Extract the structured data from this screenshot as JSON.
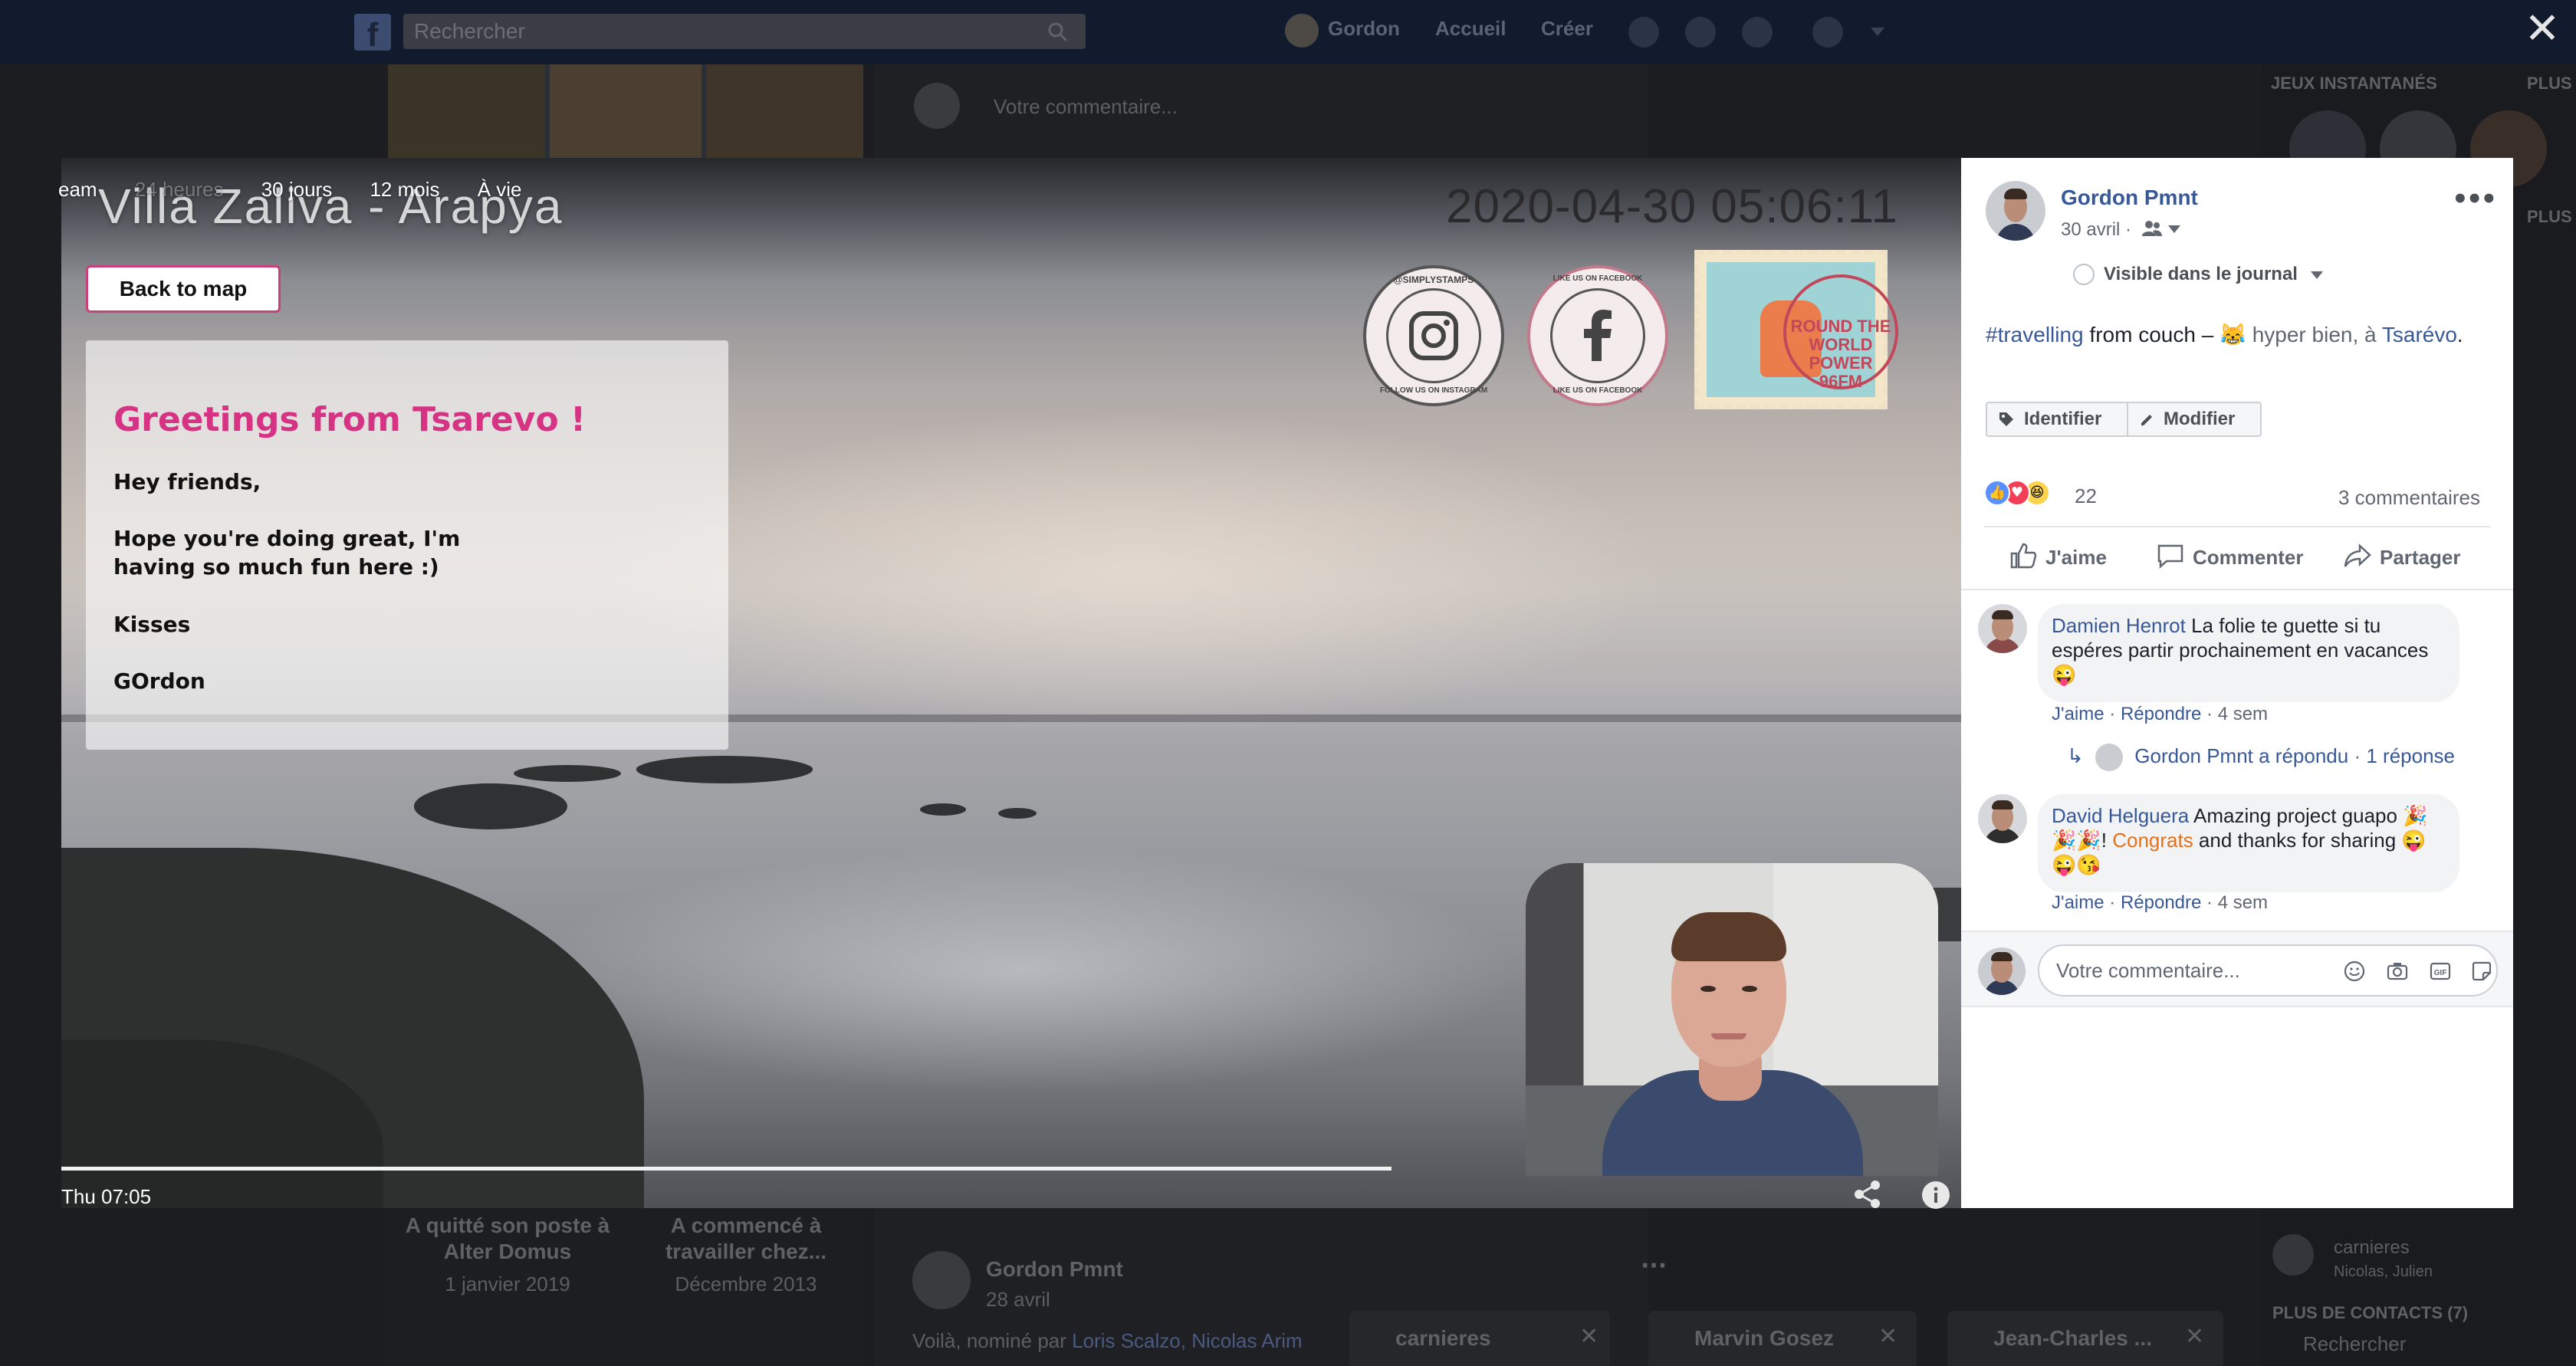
{
  "fb_header": {
    "search_placeholder": "Rechercher",
    "user_name": "Gordon",
    "nav_home": "Accueil",
    "nav_create": "Créer"
  },
  "background": {
    "left_item_1": "A quitté son poste à Alter Domus",
    "left_item_1_date": "1 janvier 2019",
    "left_item_2": "A commencé à travailler chez...",
    "left_item_2_date": "Décembre 2013",
    "comment_placeholder": "Votre commentaire...",
    "post_author": "Gordon Pmnt",
    "post_date": "28 avril",
    "post_text_start": "Voilà, nominé par",
    "post_text_links": "Loris Scalzo, Nicolas Arim",
    "right_title": "JEUX INSTANTANÉS",
    "right_plus": "PLUS",
    "right_plus2": "PLUS",
    "contacts_title": "PLUS DE CONTACTS (7)",
    "contact_name": "carnieres",
    "contact_sub": "Nicolas, Julien",
    "search_bottom": "Rechercher",
    "chat_1": "carnieres",
    "chat_2": "Marvin Gosez",
    "chat_3": "Jean-Charles ..."
  },
  "video": {
    "tabs": [
      "eam",
      "24 heures",
      "30 jours",
      "12 mois",
      "À vie"
    ],
    "location": "Villa   Zaliva  -  Arapya",
    "datetime": "2020-04-30  05:06:11",
    "back_button": "Back to map",
    "card_title": "Greetings from Tsarevo !",
    "card_lines": [
      "Hey friends,",
      "Hope you're doing great, I'm having so much fun here :)",
      "Kisses",
      "GOrdon"
    ],
    "stamp_instagram_top": "@SIMPLYSTAMPS",
    "stamp_instagram_bottom": "FOLLOW US ON INSTAGRAM",
    "stamp_facebook_top": "LIKE US ON FACEBOOK",
    "stamp_facebook_bottom": "LIKE US ON FACEBOOK",
    "stamp_post_text": "ROUND THE WORLD POWER 96FM",
    "time_label": "Thu 07:05",
    "progress": 0.7
  },
  "post": {
    "author": "Gordon Pmnt",
    "date": "30 avril ·",
    "visibility": "Visible dans le journal",
    "hashtag": "#travelling",
    "caption_mid": " from couch – ",
    "caption_emoji": "😹",
    "caption_feeling": " hyper bien, à ",
    "caption_place": "Tsarévo",
    "caption_end": ".",
    "tag_button": "Identifier",
    "edit_button": "Modifier",
    "reaction_count": "22",
    "comments_count": "3 commentaires",
    "action_like": "J'aime",
    "action_comment": "Commenter",
    "action_share": "Partager",
    "comments": [
      {
        "name": "Damien Henrot",
        "text": " La folie te guette si tu espéres partir prochainement en vacances 😜",
        "like": "J'aime",
        "reply": "Répondre",
        "time": "4 sem"
      },
      {
        "name": "David Helguera",
        "text_1": " Amazing project guapo 🎉🎉🎉! ",
        "highlight": "Congrats",
        "text_2": " and thanks for sharing 😜😜😘",
        "like": "J'aime",
        "reply": "Répondre",
        "time": "4 sem"
      }
    ],
    "reply_author_text": "Gordon Pmnt a répondu",
    "reply_count": "1 réponse",
    "composer_placeholder": "Votre commentaire..."
  },
  "colors": {
    "accent_pink": "#d63384",
    "fb_link": "#385898"
  }
}
